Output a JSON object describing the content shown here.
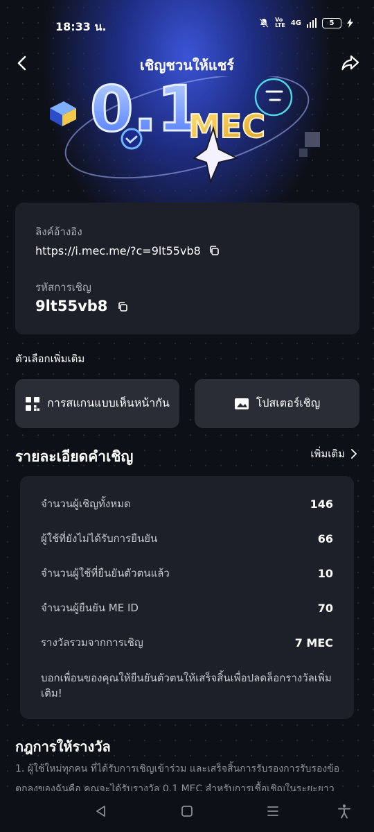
{
  "status_bar": {
    "time": "18:33 น.",
    "network_label": "4G",
    "battery_level": "5"
  },
  "header": {
    "title": "เชิญชวนให้แชร์"
  },
  "hero": {
    "amount_text": "0.1",
    "currency_text": "MEC"
  },
  "referral": {
    "link_label": "ลิงค์อ้างอิง",
    "link_value": "https://i.mec.me/?c=9lt55vb8",
    "code_label": "รหัสการเชิญ",
    "code_value": "9lt55vb8"
  },
  "options": {
    "section_label": "ตัวเลือกเพิ่มเติม",
    "face_to_face_label": "การสแกนแบบเห็นหน้ากัน",
    "poster_label": "โปสเตอร์เชิญ"
  },
  "details": {
    "title": "รายละเอียดคำเชิญ",
    "more_label": "เพิ่มเติม",
    "rows": [
      {
        "label": "จำนวนผู้เชิญทั้งหมด",
        "value": "146"
      },
      {
        "label": "ผู้ใช้ที่ยังไม่ได้รับการยืนยัน",
        "value": "66"
      },
      {
        "label": "จำนวนผู้ใช้ที่ยืนยันตัวตนแล้ว",
        "value": "10"
      },
      {
        "label": "จำนวนผู้ยืนยัน ME ID",
        "value": "70"
      },
      {
        "label": "รางวัลรวมจากการเชิญ",
        "value": "7 MEC"
      }
    ],
    "note": "บอกเพื่อนของคุณให้ยืนยันตัวตนให้เสร็จสิ้นเพื่อปลดล็อกรางวัลเพิ่มเติม!"
  },
  "rules": {
    "title": "กฎการให้รางวัล",
    "text": "1. ผู้ใช้ใหม่ทุกคน ที่ได้รับการเชิญเข้าร่วม และเสร็จสิ้นการรับรองการรับรองข้อตกลงของฉันคือ คุณจะได้รับรางวัล 0.1 MEC สำหรับการเชื้อเชิญในระยะยาว"
  },
  "colors": {
    "background": "#0e1017",
    "card": "#1e2029",
    "button": "#2a2c36",
    "hero_blue": "#3b54d6",
    "accent_yellow": "#f2c94c"
  }
}
